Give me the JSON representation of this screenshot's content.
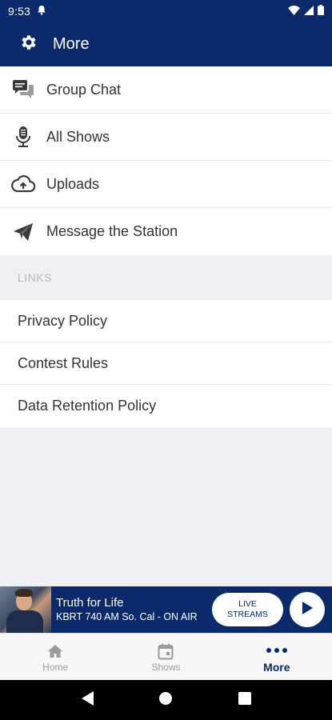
{
  "status_bar": {
    "time": "9:53"
  },
  "app_bar": {
    "title": "More",
    "icon": "gear-icon"
  },
  "menu": {
    "items": [
      {
        "label": "Group Chat",
        "icon": "chat-icon"
      },
      {
        "label": "All Shows",
        "icon": "microphone-icon"
      },
      {
        "label": "Uploads",
        "icon": "cloud-upload-icon"
      },
      {
        "label": "Message the Station",
        "icon": "paper-plane-icon"
      }
    ]
  },
  "links": {
    "header": "LINKS",
    "items": [
      {
        "label": "Privacy Policy"
      },
      {
        "label": "Contest Rules"
      },
      {
        "label": "Data Retention Policy"
      }
    ]
  },
  "player": {
    "title": "Truth for Life",
    "subtitle": "KBRT 740 AM So. Cal - ON AIR",
    "live_line1": "LIVE",
    "live_line2": "STREAMS"
  },
  "tabs": [
    {
      "label": "Home",
      "icon": "home-icon",
      "active": false
    },
    {
      "label": "Shows",
      "icon": "calendar-icon",
      "active": false
    },
    {
      "label": "More",
      "icon": "more-dots-icon",
      "active": true
    }
  ],
  "colors": {
    "primary": "#0b2a6b",
    "background": "#efeff4"
  }
}
